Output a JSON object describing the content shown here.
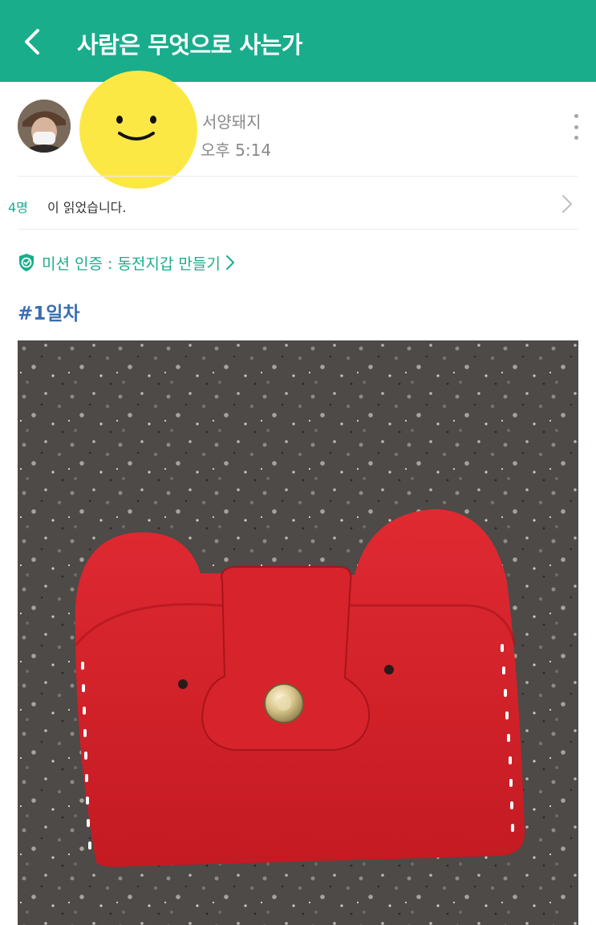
{
  "appbar": {
    "title": "사람은 무엇으로 사는가",
    "back_icon": "chevron-left-icon",
    "background": "#19ad8c"
  },
  "post": {
    "author": {
      "nickname": "서양돼지",
      "time": "오후 5:14"
    },
    "readers": {
      "count": "4명",
      "suffix": "이 읽었습니다."
    },
    "mission": {
      "label": "미션 인증 : 동전지갑 만들기"
    },
    "tag": "#1일차",
    "photo_description_icon": "photo-image"
  },
  "colors": {
    "accent": "#19ad8c",
    "tag": "#3a6fb0",
    "muted": "#8a8a8a",
    "sticker": "#fce845"
  }
}
